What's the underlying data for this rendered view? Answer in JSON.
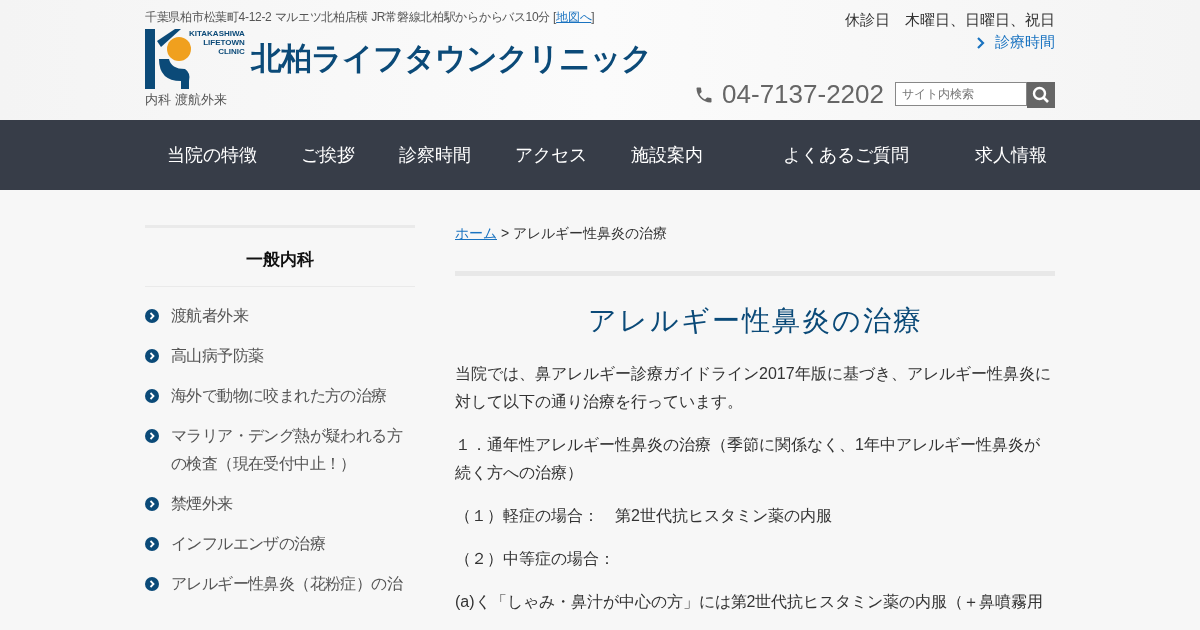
{
  "header": {
    "address": "千葉県柏市松葉町4-12-2 マルエツ北柏店横  JR常磐線北柏駅からからバス10分 [",
    "map_link": "地図へ",
    "address_end": "]",
    "logo": {
      "small_lines": [
        "KITAKASHIWA",
        "LIFETOWN",
        "CLINIC"
      ],
      "name": "北柏ライフタウンクリニック"
    },
    "departments": "内科 渡航外来",
    "closed_days": "休診日　木曜日、日曜日、祝日",
    "hours_link": "診療時間",
    "phone": "04-7137-2202",
    "search": {
      "placeholder": "サイト内検索"
    }
  },
  "nav": [
    {
      "label": "当院の特徴"
    },
    {
      "label": "ご挨拶"
    },
    {
      "label": "診察時間"
    },
    {
      "label": "アクセス"
    },
    {
      "label": "施設案内"
    },
    {
      "label": "よくあるご質問"
    },
    {
      "label": "求人情報"
    }
  ],
  "sidebar": {
    "title": "一般内科",
    "items": [
      {
        "label": "渡航者外来"
      },
      {
        "label": "高山病予防薬"
      },
      {
        "label": "海外で動物に咬まれた方の治療"
      },
      {
        "label": "マラリア・デング熱が疑われる方の検査（現在受付中止！）"
      },
      {
        "label": "禁煙外来"
      },
      {
        "label": "インフルエンザの治療"
      },
      {
        "label": "アレルギー性鼻炎（花粉症）の治"
      }
    ]
  },
  "breadcrumb": {
    "home": "ホーム",
    "separator": ">",
    "current": "アレルギー性鼻炎の治療"
  },
  "article": {
    "title": "アレルギー性鼻炎の治療",
    "paragraphs": [
      "当院では、鼻アレルギー診療ガイドライン2017年版に基づき、アレルギー性鼻炎に対して以下の通り治療を行っています。",
      "１．通年性アレルギー性鼻炎の治療（季節に関係なく、1年中アレルギー性鼻炎が続く方への治療）",
      "（１）軽症の場合：　第2世代抗ヒスタミン薬の内服",
      "（２）中等症の場合：",
      "(a)く「しゃみ・鼻汁が中心の方」には第2世代抗ヒスタミン薬の内服（＋鼻噴霧用"
    ]
  }
}
